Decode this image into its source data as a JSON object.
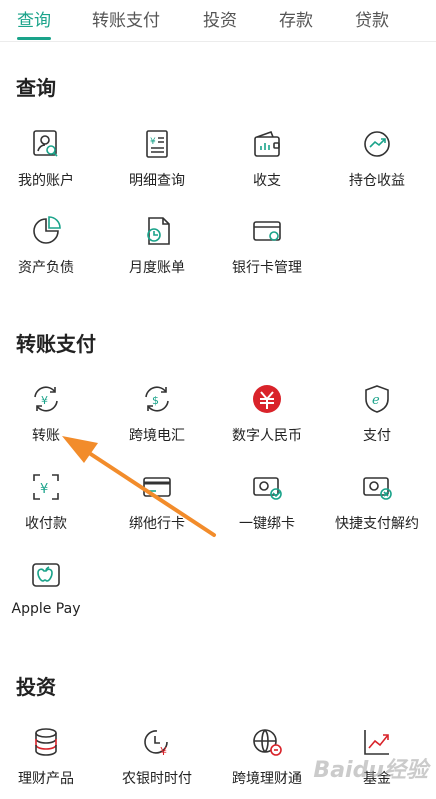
{
  "tabs": [
    {
      "label": "查询",
      "active": true
    },
    {
      "label": "转账支付",
      "active": false
    },
    {
      "label": "投资",
      "active": false
    },
    {
      "label": "存款",
      "active": false
    },
    {
      "label": "贷款",
      "active": false
    }
  ],
  "accent_color": "#1aa38a",
  "sections": {
    "query": {
      "title": "查询",
      "items": [
        {
          "label": "我的账户",
          "icon": "account-icon"
        },
        {
          "label": "明细查询",
          "icon": "statement-icon"
        },
        {
          "label": "收支",
          "icon": "wallet-icon"
        },
        {
          "label": "持仓收益",
          "icon": "trend-icon"
        },
        {
          "label": "资产负债",
          "icon": "pie-icon"
        },
        {
          "label": "月度账单",
          "icon": "bill-icon"
        },
        {
          "label": "银行卡管理",
          "icon": "card-settings-icon"
        }
      ]
    },
    "transfer": {
      "title": "转账支付",
      "items": [
        {
          "label": "转账",
          "icon": "transfer-icon"
        },
        {
          "label": "跨境电汇",
          "icon": "cross-border-icon"
        },
        {
          "label": "数字人民币",
          "icon": "digital-rmb-icon"
        },
        {
          "label": "支付",
          "icon": "epay-icon"
        },
        {
          "label": "收付款",
          "icon": "scan-pay-icon"
        },
        {
          "label": "绑他行卡",
          "icon": "bind-card-icon"
        },
        {
          "label": "一键绑卡",
          "icon": "link-card-icon"
        },
        {
          "label": "快捷支付解约",
          "icon": "unbind-card-icon"
        },
        {
          "label": "Apple Pay",
          "icon": "apple-icon"
        }
      ]
    },
    "invest": {
      "title": "投资",
      "items": [
        {
          "label": "理财产品",
          "icon": "coins-icon"
        },
        {
          "label": "农银时时付",
          "icon": "clock-yen-icon"
        },
        {
          "label": "跨境理财通",
          "icon": "globe-icon"
        },
        {
          "label": "基金",
          "icon": "chart-up-icon"
        }
      ]
    }
  },
  "watermark": "Baidu经验"
}
